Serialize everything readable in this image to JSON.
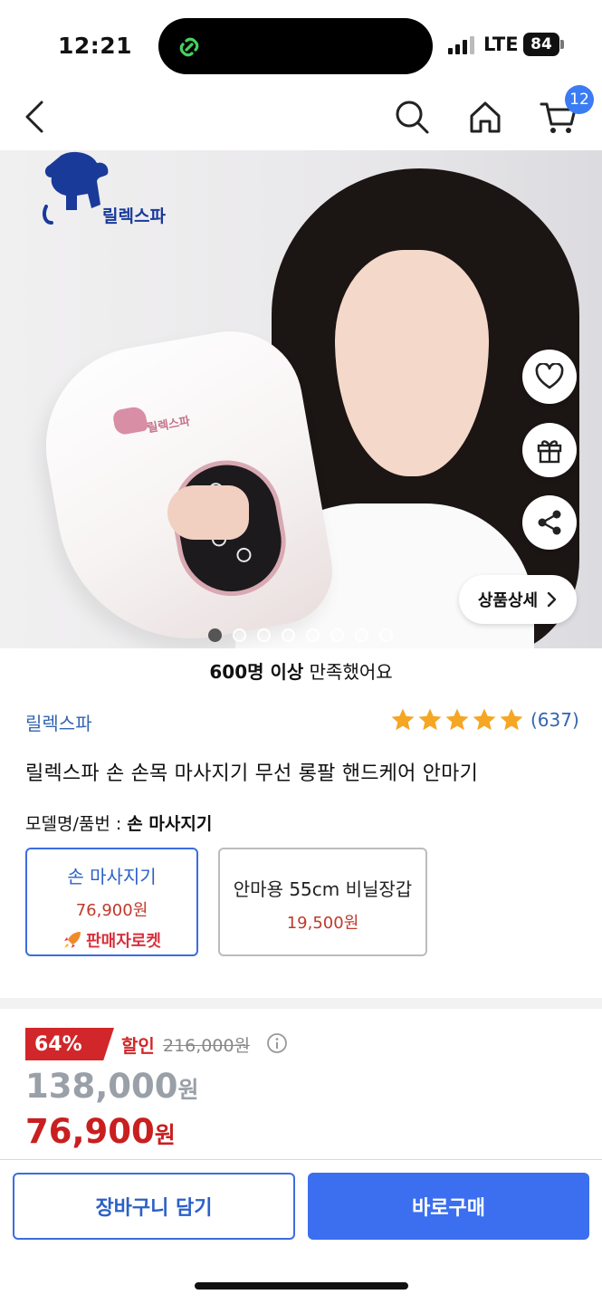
{
  "status_bar": {
    "time": "12:21",
    "network": "LTE",
    "battery": "84"
  },
  "nav": {
    "cart_count": "12"
  },
  "hero": {
    "logo_text": "릴렉스파",
    "device_brand": "릴렉스파",
    "detail_button_label": "상품상세",
    "image_count": 8,
    "active_image_index": 0
  },
  "satisfaction": {
    "bold": "600명 이상",
    "rest": " 만족했어요"
  },
  "product": {
    "seller": "릴렉스파",
    "rating": 5,
    "review_count": "(637)",
    "title": "릴렉스파 손 손목 마사지기 무선 롱팔 핸드케어 안마기",
    "model_label": "모델명/품번 : ",
    "model_value": "손 마사지기"
  },
  "options": [
    {
      "name": "손 마사지기",
      "price": "76,900원",
      "badge": "판매자로켓",
      "selected": true
    },
    {
      "name": "안마용 55cm 비닐장갑",
      "price": "19,500원",
      "selected": false
    }
  ],
  "pricing": {
    "discount_rate": "64%",
    "discount_label": "할인",
    "original_price": "216,000원",
    "list_price": "138,000",
    "sale_price": "76,900",
    "currency": "원"
  },
  "actions": {
    "cart_label": "장바구니 담기",
    "buy_label": "바로구매"
  },
  "colors": {
    "accent": "#3b6ff0",
    "sale": "#c91f1f",
    "link": "#3465b0",
    "star": "#f5a623"
  }
}
